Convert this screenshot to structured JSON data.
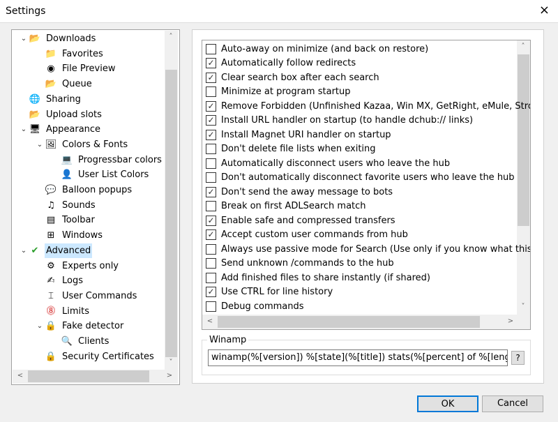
{
  "window": {
    "title": "Settings"
  },
  "tree": [
    {
      "label": "Downloads",
      "icon": "downloads-icon",
      "level": 0,
      "expanded": true
    },
    {
      "label": "Favorites",
      "icon": "favorites-folder-icon",
      "level": 1
    },
    {
      "label": "File Preview",
      "icon": "file-preview-icon",
      "level": 1
    },
    {
      "label": "Queue",
      "icon": "queue-icon",
      "level": 1
    },
    {
      "label": "Sharing",
      "icon": "sharing-icon",
      "level": 0
    },
    {
      "label": "Upload slots",
      "icon": "upload-icon",
      "level": 0
    },
    {
      "label": "Appearance",
      "icon": "appearance-icon",
      "level": 0,
      "expanded": true
    },
    {
      "label": "Colors & Fonts",
      "icon": "colors-fonts-icon",
      "level": 1,
      "expanded": true
    },
    {
      "label": "Progressbar colors",
      "icon": "progressbar-icon",
      "level": 2
    },
    {
      "label": "User List Colors",
      "icon": "user-icon",
      "level": 2
    },
    {
      "label": "Balloon popups",
      "icon": "balloon-icon",
      "level": 1
    },
    {
      "label": "Sounds",
      "icon": "music-note-icon",
      "level": 1
    },
    {
      "label": "Toolbar",
      "icon": "toolbar-icon",
      "level": 1
    },
    {
      "label": "Windows",
      "icon": "windows-logo-icon",
      "level": 1
    },
    {
      "label": "Advanced",
      "icon": "advanced-check-icon",
      "level": 0,
      "expanded": true,
      "selected": true
    },
    {
      "label": "Experts only",
      "icon": "gear-icon",
      "level": 1
    },
    {
      "label": "Logs",
      "icon": "logs-pen-icon",
      "level": 1
    },
    {
      "label": "User Commands",
      "icon": "user-commands-icon",
      "level": 1
    },
    {
      "label": "Limits",
      "icon": "speed-limit-icon",
      "level": 1
    },
    {
      "label": "Fake detector",
      "icon": "lock-icon",
      "level": 1,
      "expanded": true
    },
    {
      "label": "Clients",
      "icon": "search-clients-icon",
      "level": 2
    },
    {
      "label": "Security Certificates",
      "icon": "padlock-icon",
      "level": 1
    }
  ],
  "options": [
    {
      "label": "Auto-away on minimize (and back on restore)",
      "checked": false
    },
    {
      "label": "Automatically follow redirects",
      "checked": true
    },
    {
      "label": "Clear search box after each search",
      "checked": true
    },
    {
      "label": "Minimize at program startup",
      "checked": false
    },
    {
      "label": "Remove Forbidden (Unfinished Kazaa, Win MX, GetRight, eMule, StrongD",
      "checked": true
    },
    {
      "label": "Install URL handler on startup (to handle dchub:// links)",
      "checked": true
    },
    {
      "label": "Install Magnet URI handler on startup",
      "checked": true
    },
    {
      "label": "Don't delete file lists when exiting",
      "checked": false
    },
    {
      "label": "Automatically disconnect users who leave the hub",
      "checked": false
    },
    {
      "label": "Don't automatically disconnect favorite users who leave the hub",
      "checked": false
    },
    {
      "label": "Don't send the away message to bots",
      "checked": true
    },
    {
      "label": "Break on first ADLSearch match",
      "checked": false
    },
    {
      "label": "Enable safe and compressed transfers",
      "checked": true
    },
    {
      "label": "Accept custom user commands from hub",
      "checked": true
    },
    {
      "label": "Always use passive mode for Search (Use only if you know what this doin",
      "checked": false
    },
    {
      "label": "Send unknown /commands to the hub",
      "checked": false
    },
    {
      "label": "Add finished files to share instantly (if shared)",
      "checked": false
    },
    {
      "label": "Use CTRL for line history",
      "checked": true
    },
    {
      "label": "Debug commands",
      "checked": false
    }
  ],
  "winamp": {
    "label": "Winamp",
    "value": "winamp(%[version]) %[state](%[title]) stats(%[percent] of %[length]",
    "help": "?"
  },
  "buttons": {
    "ok": "OK",
    "cancel": "Cancel"
  },
  "icons": {
    "close": "×",
    "check": "✓",
    "up": "˄",
    "down": "˅",
    "left": "<",
    "right": ">",
    "expand": "⌄"
  }
}
